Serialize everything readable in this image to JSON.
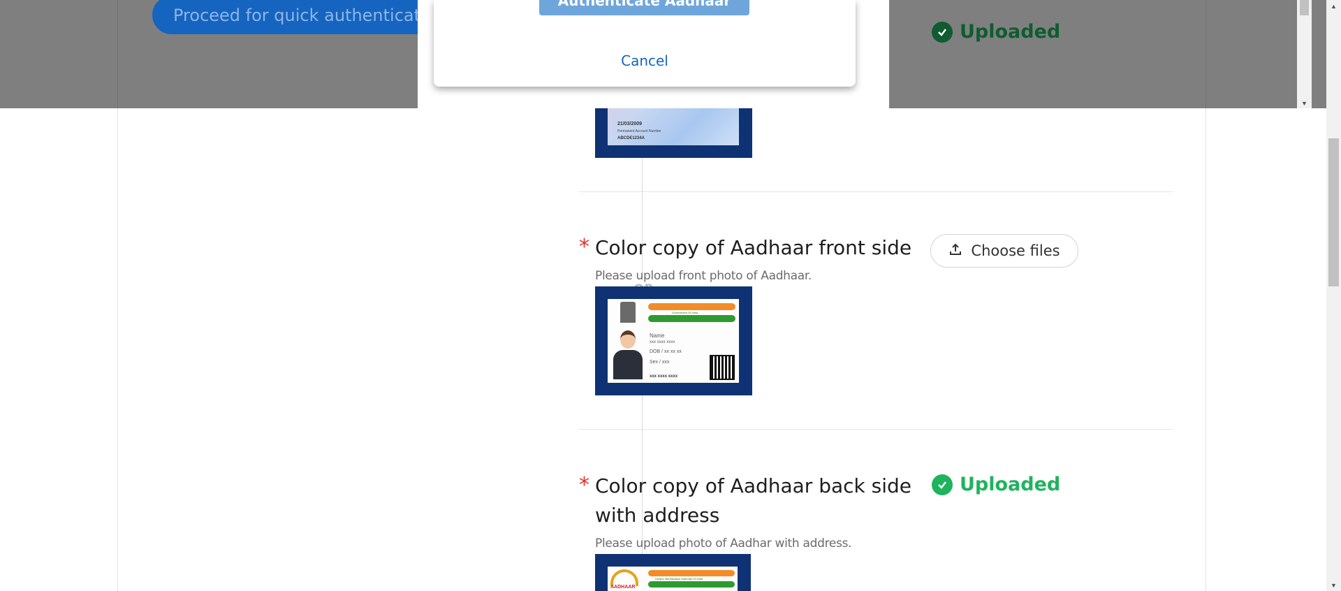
{
  "top_bar": {
    "proceed_label": "Proceed for quick authentication",
    "uploaded_label": "Uploaded"
  },
  "modal": {
    "authenticate_label": "Authenticate Aadhaar",
    "cancel_label": "Cancel"
  },
  "divider": {
    "or_label": "OR"
  },
  "documents": [
    {
      "title": "Color copy of Aadhaar front side",
      "hint": "Please upload front photo of Aadhaar.",
      "action_label": "Choose files",
      "required": "*"
    },
    {
      "title_line1": "Color copy of Aadhaar back side",
      "title_line2": "with address",
      "hint": "Please upload photo of Aadhar with address.",
      "status_label": "Uploaded",
      "required": "*"
    }
  ],
  "pan_card": {
    "date": "21/03/2009",
    "caption": "Permanent Account Number",
    "number": "ABCDE1234A"
  },
  "aadhaar_front_card": {
    "header": "Government Of India",
    "name_label": "Name",
    "name_value": "xxx xxxx xxxx",
    "dob": "DOB / xx xx xx",
    "sex": "Sex / xxx",
    "number": "xxx xxxx xxxx"
  },
  "aadhaar_back_card": {
    "logo_text": "AADHAAR",
    "header": "Unique Identification Authority Of India"
  },
  "colors": {
    "primary": "#1565c0",
    "success": "#1fb35e",
    "required": "#e5322d",
    "thumb_frame": "#0e3274"
  }
}
